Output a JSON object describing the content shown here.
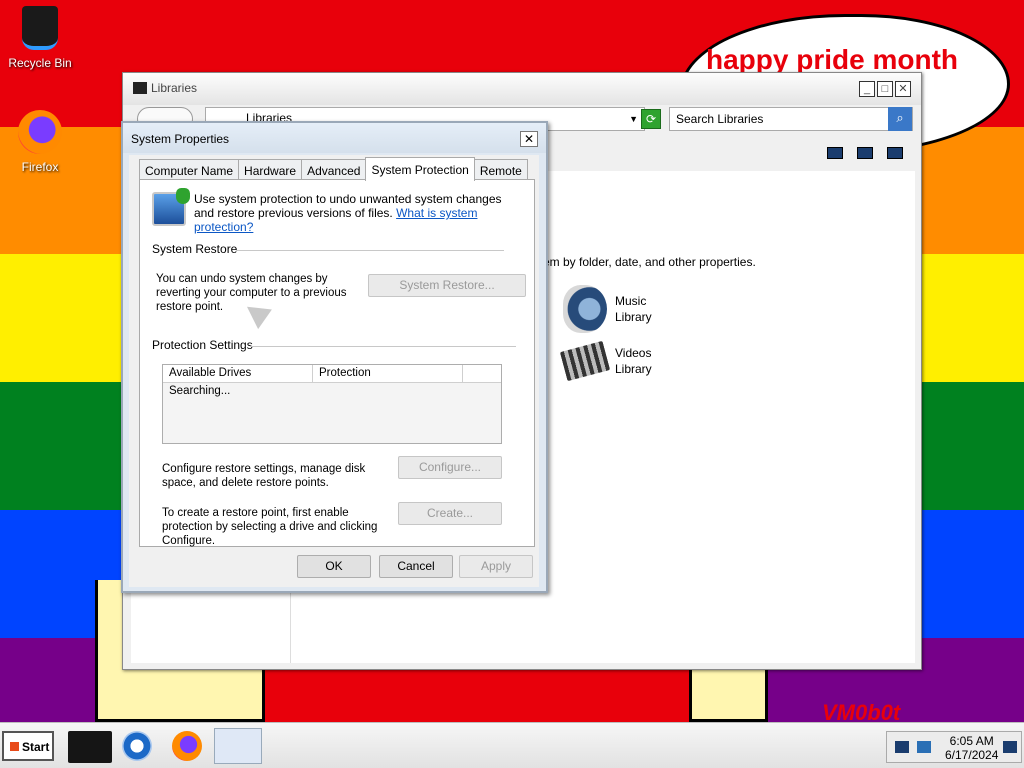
{
  "desktop": {
    "bubble_text": "happy pride month",
    "signature": "VM0b0t",
    "icons": [
      {
        "label": "Recycle Bin",
        "icon": "recycle-bin-icon"
      },
      {
        "label": "Firefox",
        "icon": "firefox-icon"
      }
    ]
  },
  "libraries": {
    "title": "Libraries",
    "address": "Libraries",
    "search_placeholder": "Search Libraries",
    "description": "em by folder, date, and other properties.",
    "items": [
      {
        "line1": "Music",
        "line2": "Library",
        "icon": "music-library-icon"
      },
      {
        "line1": "Videos",
        "line2": "Library",
        "icon": "videos-library-icon"
      }
    ]
  },
  "dialog": {
    "title": "System Properties",
    "close": "✕",
    "tabs": [
      "Computer Name",
      "Hardware",
      "Advanced",
      "System Protection",
      "Remote"
    ],
    "active_tab": "System Protection",
    "intro": "Use system protection to undo unwanted system changes and restore previous versions of files.",
    "intro_link": "What is system protection?",
    "system_restore_header": "System Restore",
    "system_restore_text": "You can undo system changes by reverting your computer to a previous restore point.",
    "system_restore_button": "System Restore...",
    "protection_header": "Protection Settings",
    "columns": [
      "Available Drives",
      "Protection"
    ],
    "rows_status": "Searching...",
    "configure_text": "Configure restore settings, manage disk space, and delete restore points.",
    "configure_button": "Configure...",
    "create_text": "To create a restore point, first enable protection by selecting a drive and clicking Configure.",
    "create_button": "Create...",
    "ok": "OK",
    "cancel": "Cancel",
    "apply": "Apply"
  },
  "taskbar": {
    "start": "Start",
    "time": "6:05 AM",
    "date": "6/17/2024"
  }
}
